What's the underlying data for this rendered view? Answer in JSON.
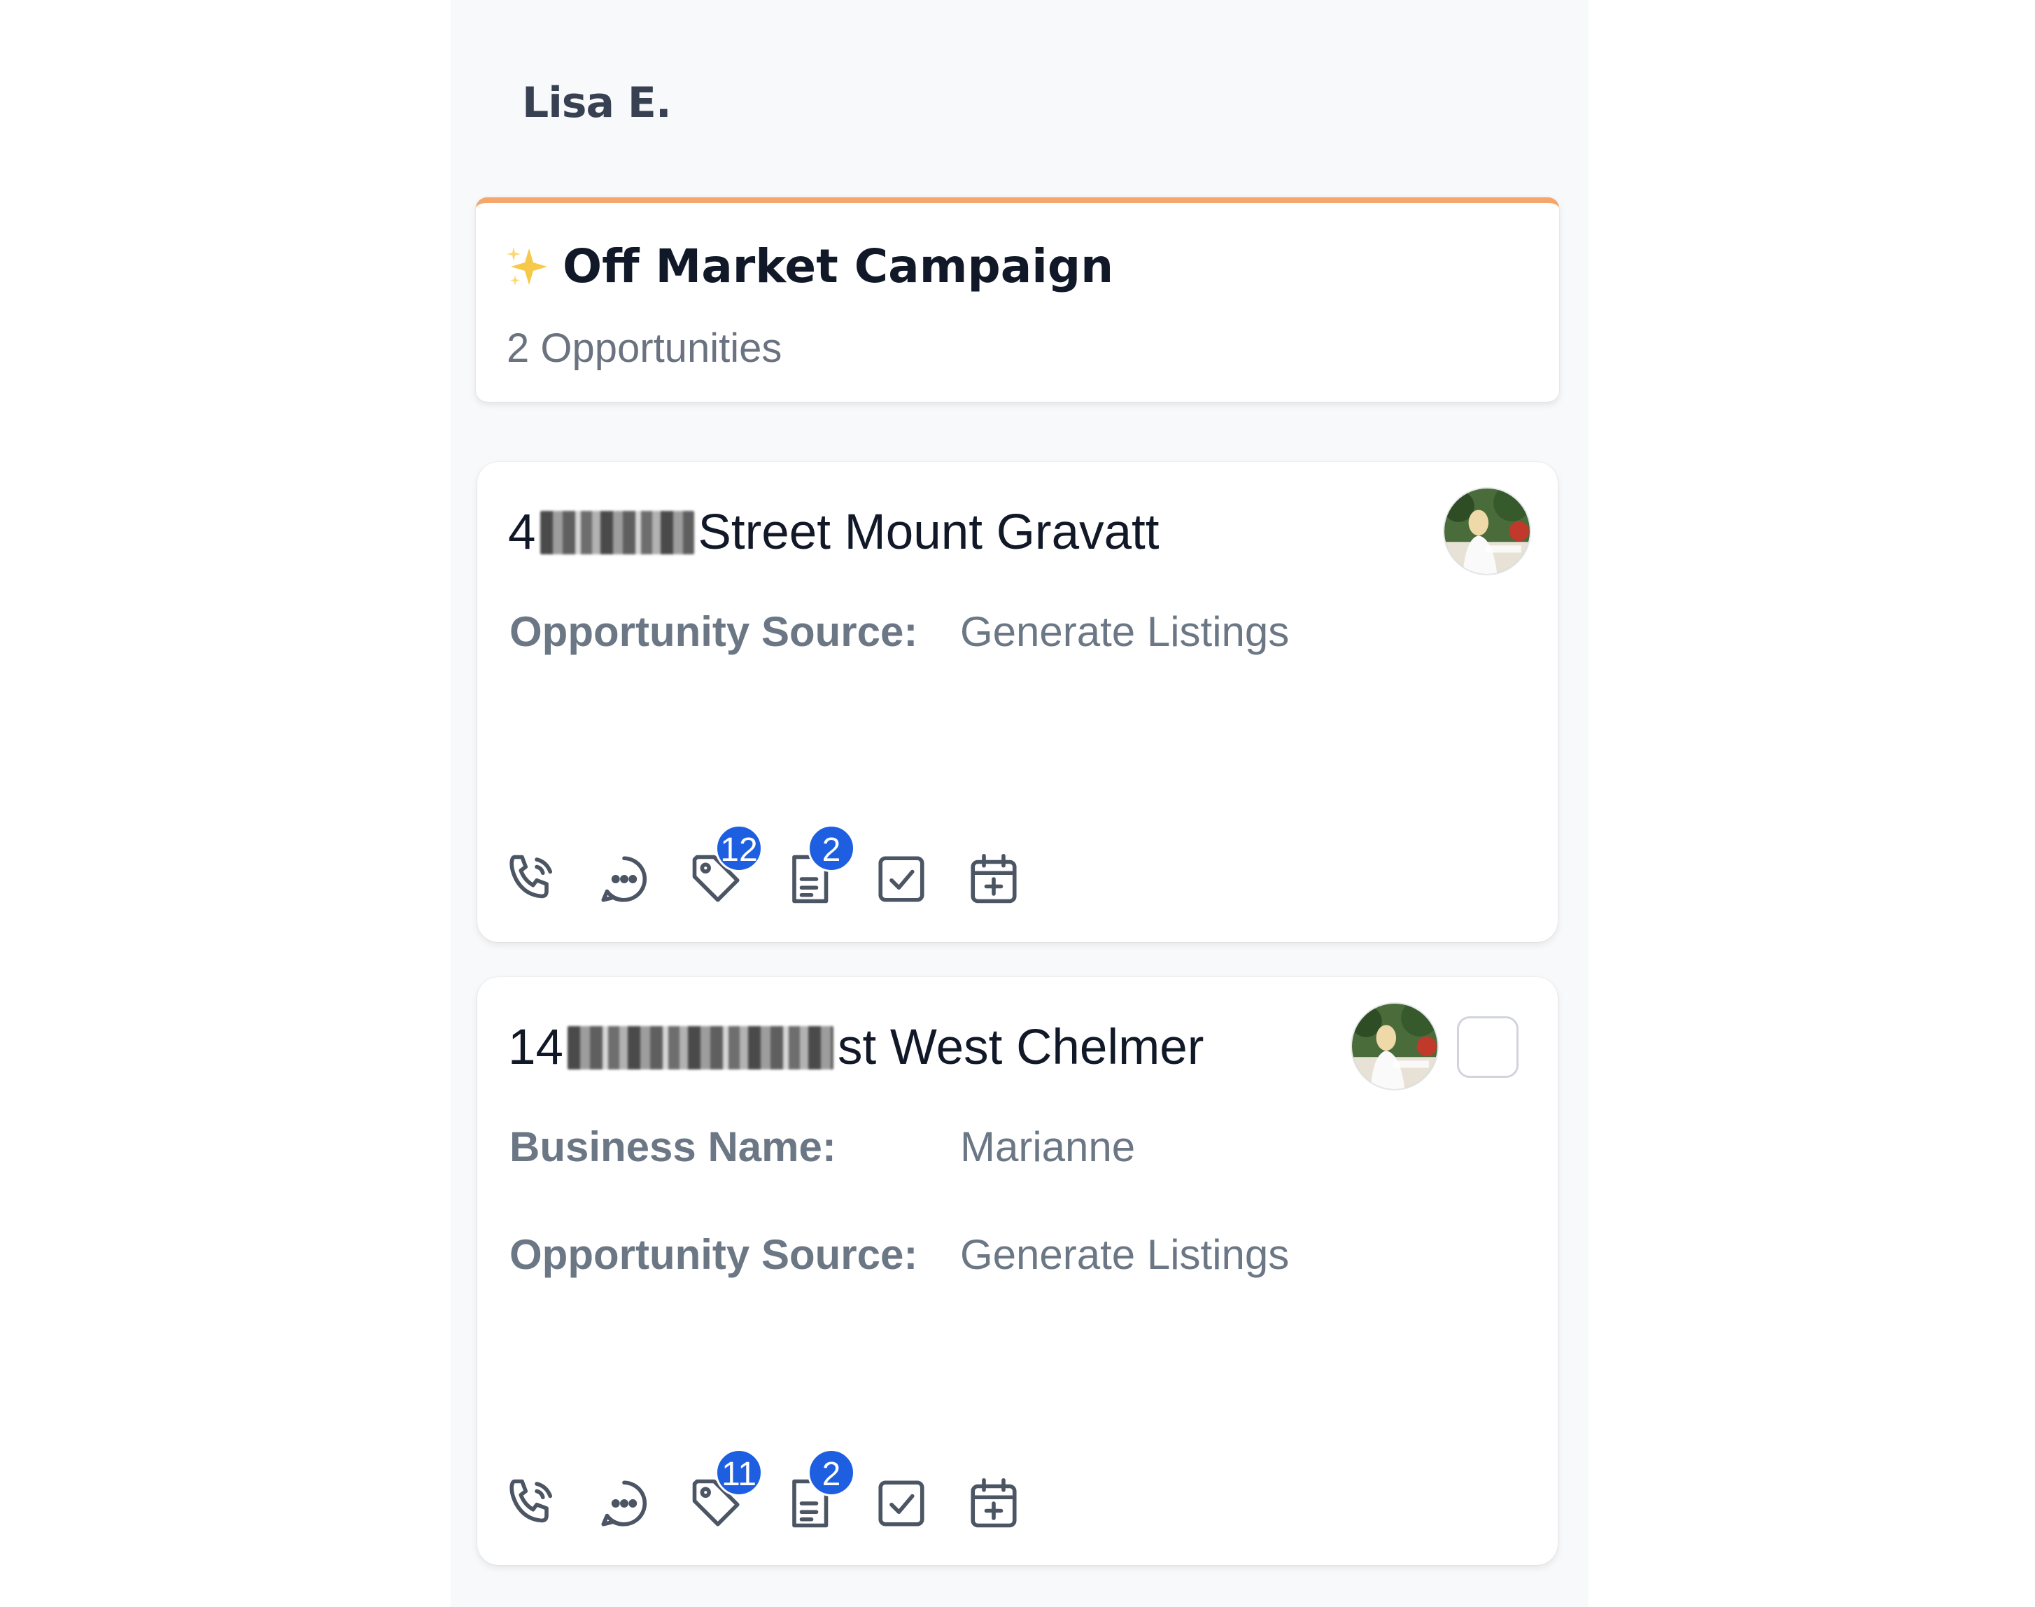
{
  "owner": {
    "name": "Lisa E."
  },
  "stage": {
    "title": "Off Market Campaign",
    "count_label": "2 Opportunities",
    "accent_color": "#f5a66b",
    "icon": "sparkles-icon"
  },
  "opportunities": [
    {
      "address_prefix": "4",
      "address_suffix": "Street Mount Gravatt",
      "fields": [
        {
          "label": "Opportunity Source:",
          "value": "Generate Listings"
        }
      ],
      "actions": [
        {
          "icon": "phone-icon"
        },
        {
          "icon": "chat-icon"
        },
        {
          "icon": "tag-icon",
          "badge": "12"
        },
        {
          "icon": "notes-icon",
          "badge": "2"
        },
        {
          "icon": "task-icon"
        },
        {
          "icon": "calendar-add-icon"
        }
      ]
    },
    {
      "address_prefix": "14",
      "address_suffix": "st West Chelmer",
      "fields": [
        {
          "label": "Business Name:",
          "value": "Marianne"
        },
        {
          "label": "Opportunity Source:",
          "value": "Generate Listings"
        }
      ],
      "actions": [
        {
          "icon": "phone-icon"
        },
        {
          "icon": "chat-icon"
        },
        {
          "icon": "tag-icon",
          "badge": "11"
        },
        {
          "icon": "notes-icon",
          "badge": "2"
        },
        {
          "icon": "task-icon"
        },
        {
          "icon": "calendar-add-icon"
        }
      ]
    }
  ],
  "colors": {
    "badge": "#1d5fe0",
    "label": "#6b7785",
    "title": "#111827"
  }
}
